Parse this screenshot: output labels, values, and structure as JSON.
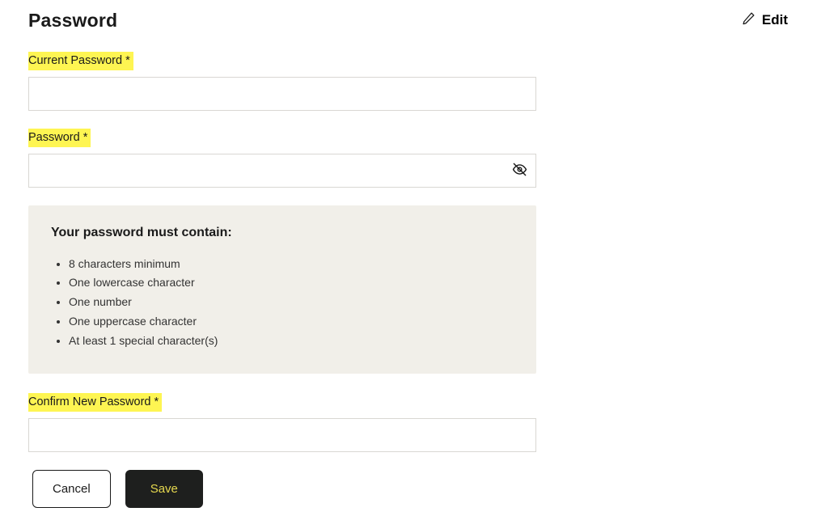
{
  "header": {
    "title": "Password",
    "edit": "Edit"
  },
  "fields": {
    "current": {
      "label": "Current Password *",
      "value": ""
    },
    "password": {
      "label": "Password *",
      "value": ""
    },
    "confirm": {
      "label": "Confirm New Password *",
      "value": ""
    }
  },
  "requirements": {
    "title": "Your password must contain:",
    "items": [
      "8 characters minimum",
      "One lowercase character",
      "One number",
      "One uppercase character",
      "At least 1 special character(s)"
    ]
  },
  "actions": {
    "cancel": "Cancel",
    "save": "Save"
  }
}
